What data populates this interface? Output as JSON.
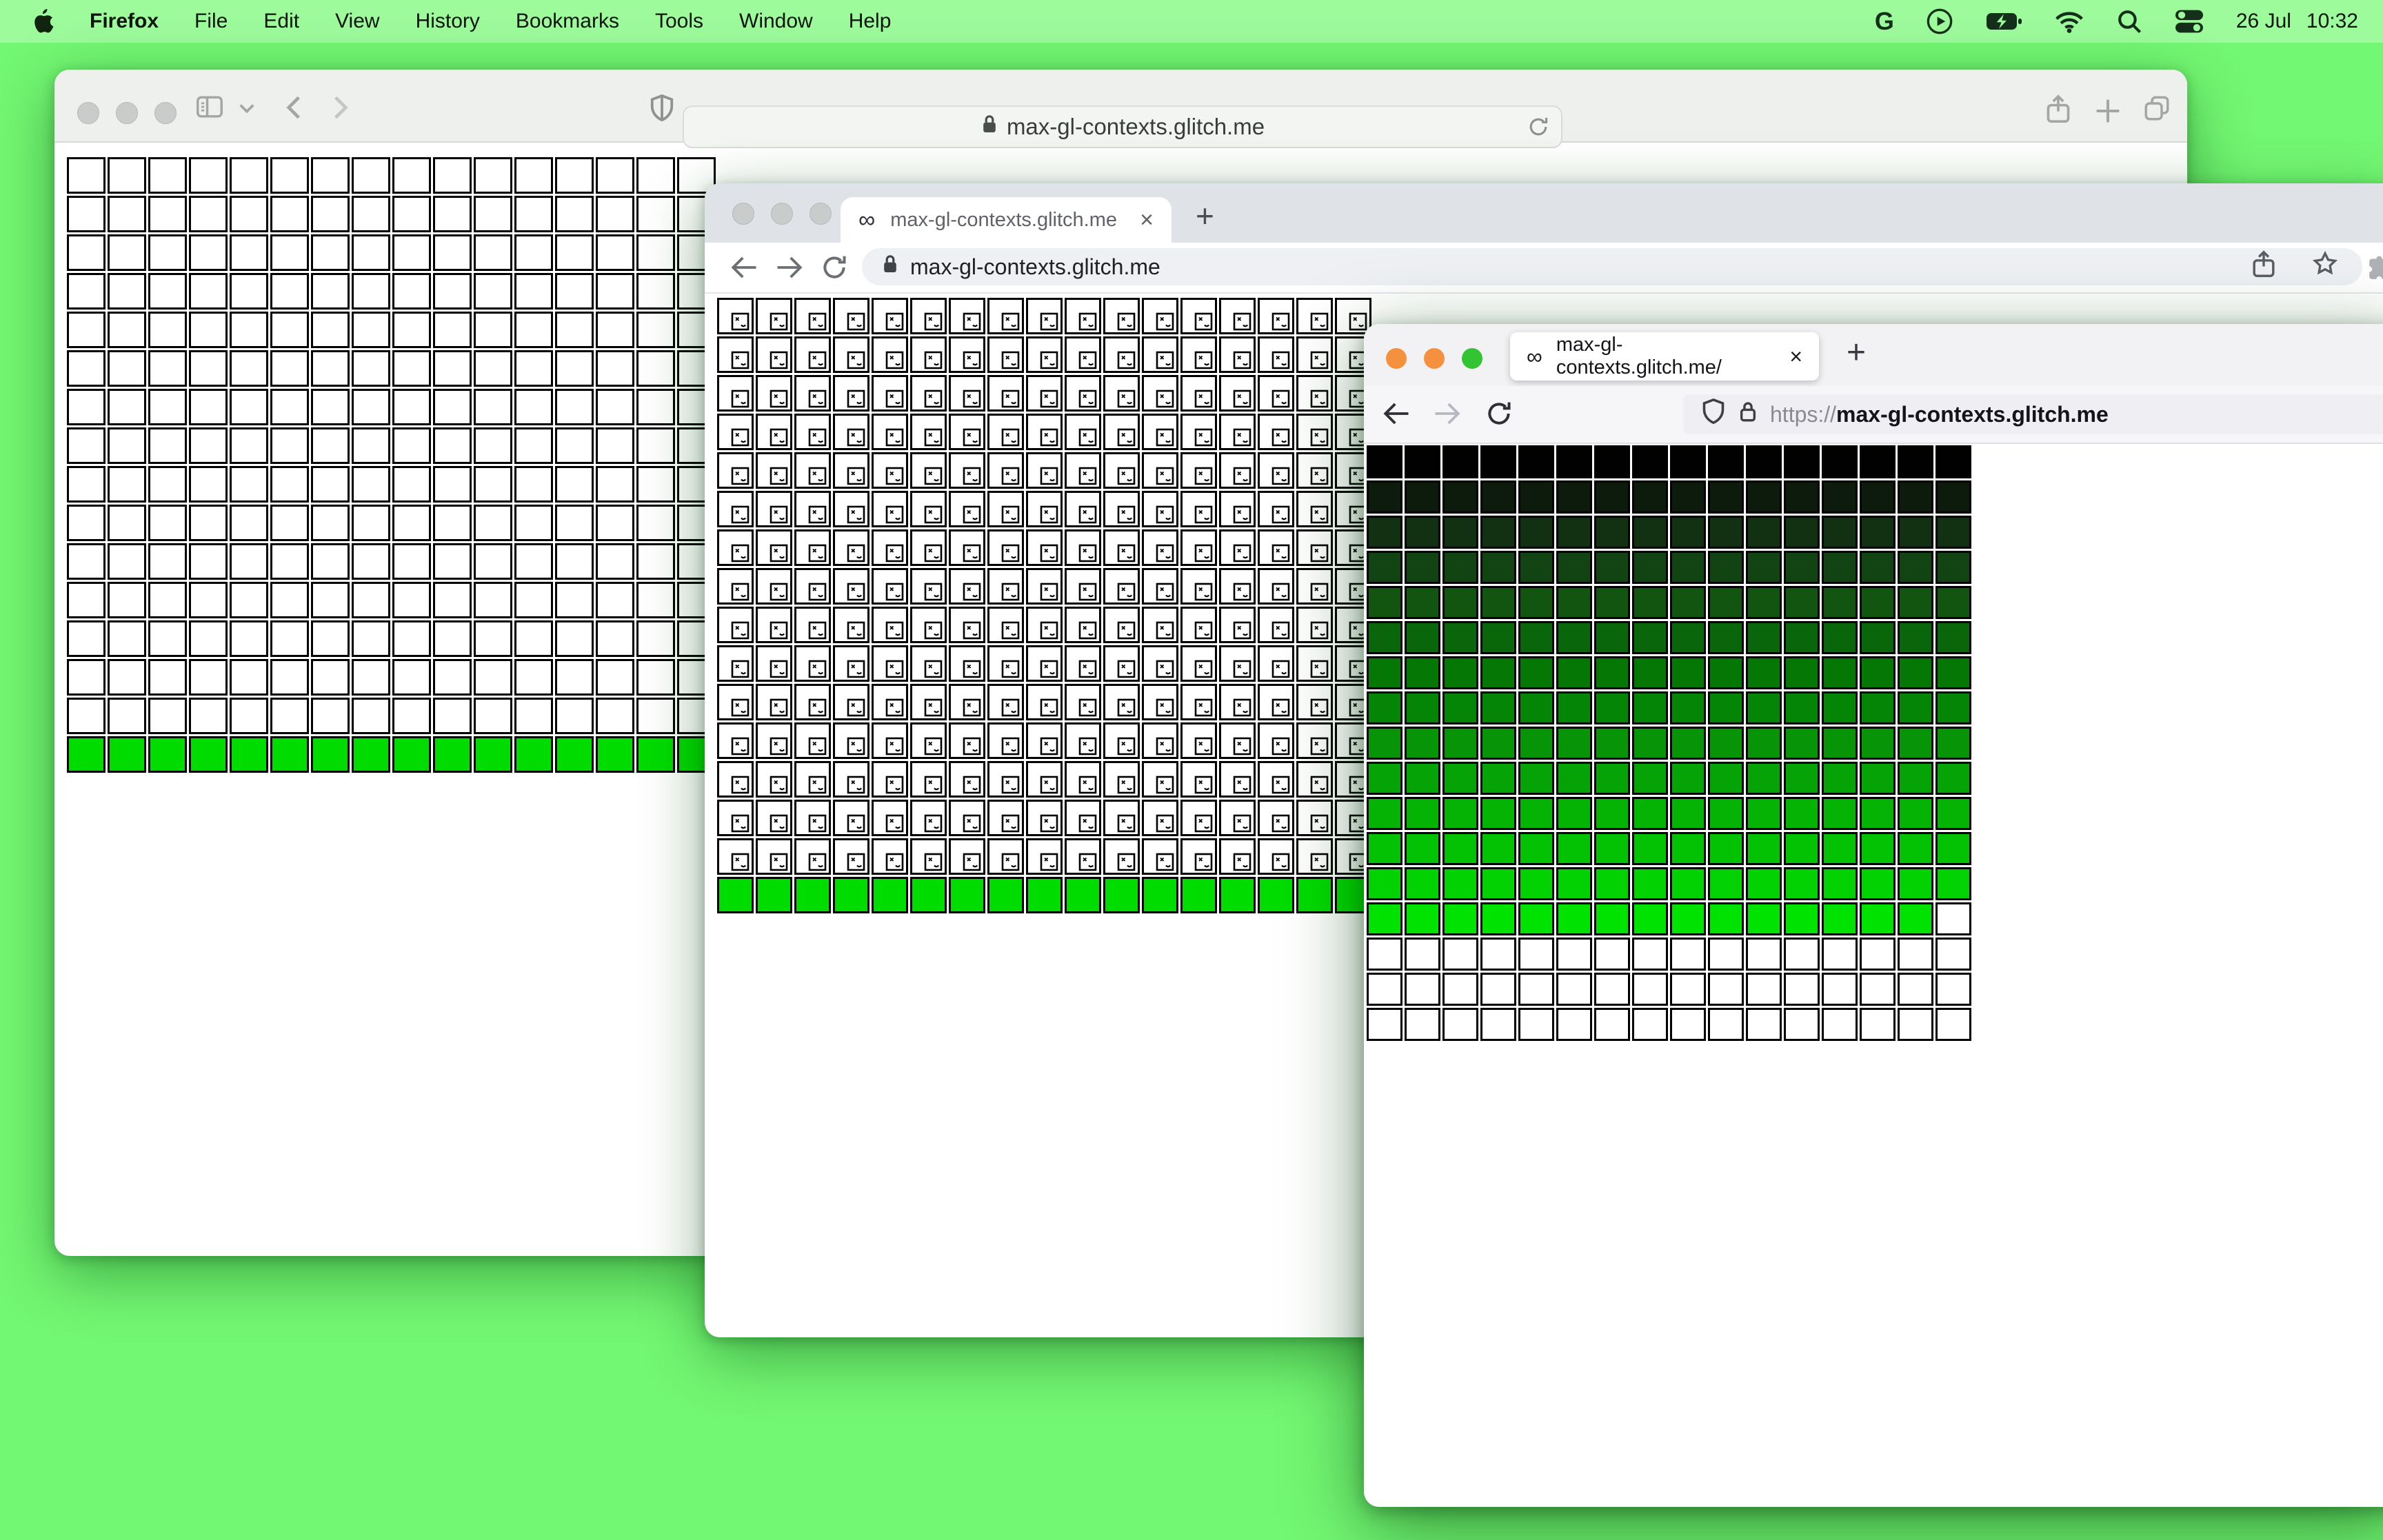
{
  "menu_bar": {
    "app_name": "Firefox",
    "items": [
      "File",
      "Edit",
      "View",
      "History",
      "Bookmarks",
      "Tools",
      "Window",
      "Help"
    ],
    "status_icons": [
      "google-icon",
      "play-icon",
      "battery-charging-icon",
      "wifi-icon",
      "search-icon",
      "control-center-icon"
    ],
    "google_glyph": "G",
    "date": "26 Jul",
    "time": "10:32"
  },
  "colors": {
    "desktop_bg": "#73f873",
    "menubar_bg": "#9dfb9c",
    "lime_cell": "#00dc00",
    "chrome_tabbar_bg": "#dfe2e7",
    "firefox_tabbar_bg": "#f2f1f4",
    "traffic_inactive": "#c9cccb",
    "traffic_orange": "#f5913e",
    "traffic_green": "#32c433"
  },
  "safari_window": {
    "url": "max-gl-contexts.glitch.me",
    "grid": {
      "cols": 16,
      "rows": 16,
      "green_row_index": 15,
      "green_color": "#00dc00"
    }
  },
  "chrome_window": {
    "tab_title": "max-gl-contexts.glitch.me",
    "tab_favicon": "∞",
    "close_glyph": "×",
    "newtab_glyph": "+",
    "url": "max-gl-contexts.glitch.me",
    "grid": {
      "cols": 17,
      "rows": 16,
      "green_row_index": 15,
      "green_color": "#00dc00"
    }
  },
  "firefox_window": {
    "tab_title": "max-gl-contexts.glitch.me/",
    "tab_favicon": "∞",
    "close_glyph": "×",
    "newtab_glyph": "+",
    "url_scheme": "https://",
    "url_host": "max-gl-contexts.glitch.me",
    "grid": {
      "cols": 16,
      "gradient_row_colors": [
        "#010101",
        "#0c1b0c",
        "#123012",
        "#124312",
        "#115511",
        "#0a660a",
        "#047704",
        "#058505",
        "#079407",
        "#06a306",
        "#05b305",
        "#03c203",
        "#02d102",
        "#00e300"
      ],
      "last_gradient_row_green_cells": 15,
      "trailing_white_rows": 3
    }
  }
}
